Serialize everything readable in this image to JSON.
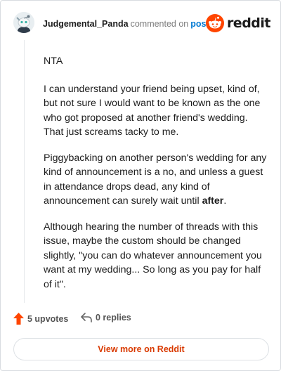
{
  "header": {
    "username": "Judgemental_Panda",
    "action_text": "commented on",
    "post_link": "post",
    "brand": "reddit"
  },
  "comment": {
    "paragraphs": [
      "NTA",
      "I can understand your friend being upset, kind of, but not sure I would want to be known as the one who got proposed at another friend's wedding. That just screams tacky to me.",
      "Although hearing the number of threads with this issue, maybe the custom should be changed slightly, \"you can do whatever announcement you want at my wedding... So long as you pay for half of it\"."
    ],
    "p3": {
      "before": "Piggybacking on another person's wedding for any kind of announcement is a no, and unless a guest in attendance drops dead, any kind of announcement can surely wait until ",
      "bold": "after",
      "after": "."
    }
  },
  "footer": {
    "upvotes": "5 upvotes",
    "replies": "0 replies",
    "view_more": "View more on Reddit"
  },
  "colors": {
    "accent_orange": "#ff4500",
    "link_blue": "#0079d3",
    "view_more_text": "#d93a00"
  },
  "icons": {
    "avatar": "snoo-avatar",
    "brand_logo": "reddit-snoo-icon",
    "upvote": "arrow-up-icon",
    "reply": "reply-arrow-icon"
  }
}
